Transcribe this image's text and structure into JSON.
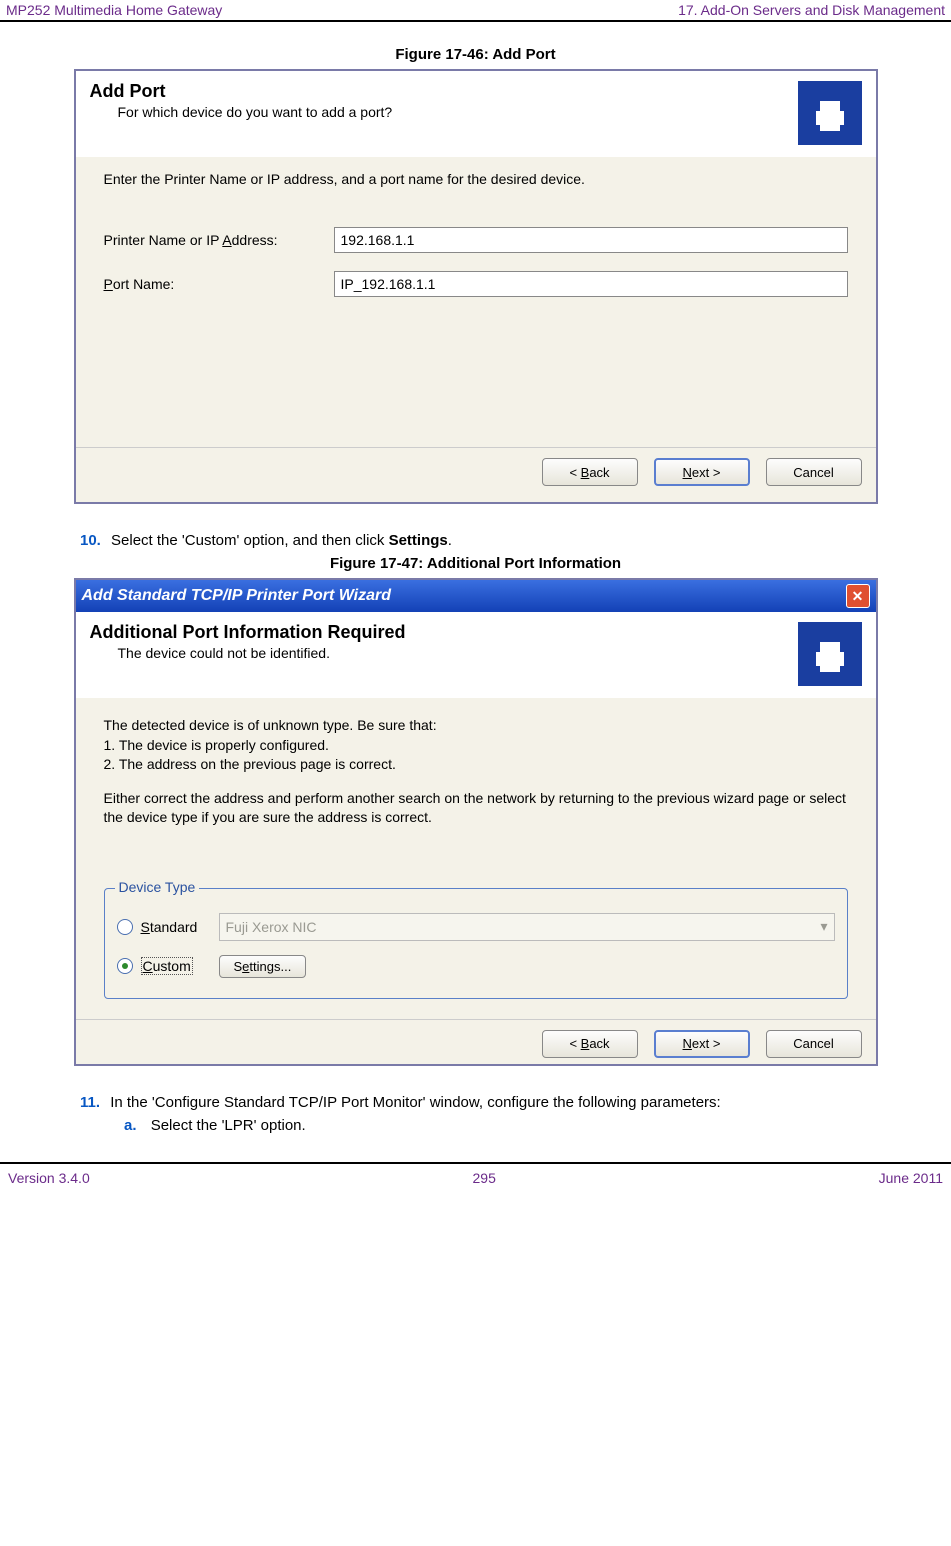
{
  "header": {
    "left": "MP252 Multimedia Home Gateway",
    "right": "17. Add-On Servers and Disk Management"
  },
  "figure1": {
    "caption": "Figure 17-46: Add Port",
    "title": "Add Port",
    "subtitle": "For which device do you want to add a port?",
    "instruction": "Enter the Printer Name or IP address, and a port name for the desired device.",
    "label_printer_pre": "Printer Name or IP ",
    "label_printer_u": "A",
    "label_printer_post": "ddress:",
    "label_port_u": "P",
    "label_port_post": "ort Name:",
    "value_printer": "192.168.1.1",
    "value_port": "IP_192.168.1.1",
    "btn_back_pre": "< ",
    "btn_back_u": "B",
    "btn_back_post": "ack",
    "btn_next_u": "N",
    "btn_next_post": "ext >",
    "btn_cancel": "Cancel"
  },
  "step10": {
    "num": "10.",
    "text_pre": "Select the 'Custom' option, and then click ",
    "bold": "Settings",
    "text_post": "."
  },
  "figure2": {
    "caption": "Figure 17-47: Additional Port Information",
    "titlebar": "Add Standard TCP/IP Printer Port Wizard",
    "heading": "Additional Port Information Required",
    "subheading": "The device could not be identified.",
    "body_line1": "The detected device is of unknown type.  Be sure that:",
    "body_line2": "1. The device is properly configured.",
    "body_line3": "2.  The address on the previous page is correct.",
    "body_line4": "Either correct the address and perform another search on the network by returning to the previous wizard page or select the device type if you are sure the address is correct.",
    "group_label": "Device Type",
    "radio_standard_u": "S",
    "radio_standard_post": "tandard",
    "dropdown_value": "Fuji Xerox NIC",
    "radio_custom_u": "C",
    "radio_custom_post": "ustom",
    "settings_pre": "S",
    "settings_u": "e",
    "settings_post": "ttings...",
    "btn_back_pre": "< ",
    "btn_back_u": "B",
    "btn_back_post": "ack",
    "btn_next_u": "N",
    "btn_next_post": "ext >",
    "btn_cancel": "Cancel"
  },
  "step11": {
    "num": "11.",
    "text": "In the 'Configure Standard TCP/IP Port Monitor' window, configure the following parameters:",
    "sub_a_label": "a.",
    "sub_a_text": "Select the 'LPR' option."
  },
  "footer": {
    "left": "Version 3.4.0",
    "center": "295",
    "right": "June 2011"
  }
}
